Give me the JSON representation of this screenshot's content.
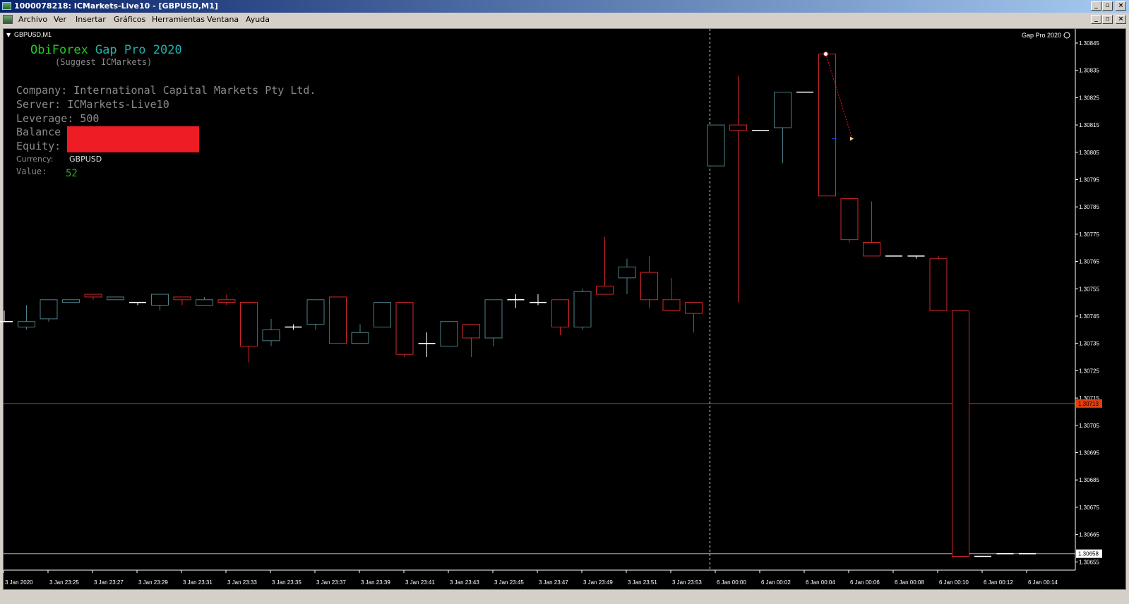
{
  "window": {
    "title": "1000078218: ICMarkets-Live10 - [GBPUSD,M1]"
  },
  "menu": [
    "Archivo",
    "Ver",
    "Insertar",
    "Gráficos",
    "Herramientas",
    "Ventana",
    "Ayuda"
  ],
  "chart": {
    "symbol_label": "GBPUSD,M1",
    "indicator_label": "Gap Pro 2020",
    "overlay": {
      "title_part1": "ObiForex",
      "title_part2": "Gap Pro 2020",
      "subtitle": "(Suggest ICMarkets)",
      "company": "Company: International Capital Markets Pty Ltd.",
      "server": "Server: ICMarkets-Live10",
      "leverage": "Leverage: 500",
      "balance_label": "Balance",
      "equity_label": "Equity:",
      "currency_label": "Currency:",
      "currency_value": "GBPUSD",
      "value_label": "Value:",
      "value_value": "52"
    },
    "price_labels": [
      "1.30845",
      "1.30835",
      "1.30825",
      "1.30815",
      "1.30805",
      "1.30795",
      "1.30785",
      "1.30775",
      "1.30765",
      "1.30755",
      "1.30745",
      "1.30735",
      "1.30725",
      "1.30715",
      "1.30705",
      "1.30695",
      "1.30685",
      "1.30675",
      "1.30665",
      "1.30655"
    ],
    "hline_red_price": 1.30713,
    "hline_red_label": "1.30713",
    "hline_gray_price": 1.30658,
    "hline_gray_label": "1.30658",
    "time_labels": [
      "3 Jan 2020",
      "3 Jan 23:25",
      "3 Jan 23:27",
      "3 Jan 23:29",
      "3 Jan 23:31",
      "3 Jan 23:33",
      "3 Jan 23:35",
      "3 Jan 23:37",
      "3 Jan 23:39",
      "3 Jan 23:41",
      "3 Jan 23:43",
      "3 Jan 23:45",
      "3 Jan 23:47",
      "3 Jan 23:49",
      "3 Jan 23:51",
      "3 Jan 23:53",
      "6 Jan 00:00",
      "6 Jan 00:02",
      "6 Jan 00:04",
      "6 Jan 00:06",
      "6 Jan 00:08",
      "6 Jan 00:10",
      "6 Jan 00:12",
      "6 Jan 00:14"
    ],
    "period_separator_after_bar": 31,
    "colors": {
      "bull": "#4d7f88",
      "bear": "#d22727",
      "doji": "#ffffff",
      "grid_red": "#c0392b",
      "balance_box": "#ee1c25",
      "title_green": "#22cc22",
      "title_teal": "#20b2aa",
      "info_gray": "#8a8a8a",
      "value_green": "#22aa22"
    },
    "candles": [
      {
        "o": 1.30743,
        "h": 1.30747,
        "l": 1.30743,
        "c": 1.30743
      },
      {
        "o": 1.30741,
        "h": 1.30749,
        "l": 1.3074,
        "c": 1.30743
      },
      {
        "o": 1.30744,
        "h": 1.30751,
        "l": 1.30743,
        "c": 1.30751
      },
      {
        "o": 1.3075,
        "h": 1.30751,
        "l": 1.3075,
        "c": 1.30751
      },
      {
        "o": 1.30753,
        "h": 1.30753,
        "l": 1.30751,
        "c": 1.30752
      },
      {
        "o": 1.30751,
        "h": 1.30752,
        "l": 1.30751,
        "c": 1.30752
      },
      {
        "o": 1.3075,
        "h": 1.3075,
        "l": 1.30749,
        "c": 1.3075
      },
      {
        "o": 1.30749,
        "h": 1.30753,
        "l": 1.30747,
        "c": 1.30753
      },
      {
        "o": 1.30752,
        "h": 1.30752,
        "l": 1.30749,
        "c": 1.30751
      },
      {
        "o": 1.30749,
        "h": 1.30752,
        "l": 1.30749,
        "c": 1.30751
      },
      {
        "o": 1.30751,
        "h": 1.30753,
        "l": 1.30749,
        "c": 1.3075
      },
      {
        "o": 1.3075,
        "h": 1.3075,
        "l": 1.30728,
        "c": 1.30734
      },
      {
        "o": 1.30736,
        "h": 1.30744,
        "l": 1.30734,
        "c": 1.3074
      },
      {
        "o": 1.30741,
        "h": 1.30742,
        "l": 1.3074,
        "c": 1.30741
      },
      {
        "o": 1.30742,
        "h": 1.30751,
        "l": 1.3074,
        "c": 1.30751
      },
      {
        "o": 1.30752,
        "h": 1.30752,
        "l": 1.30735,
        "c": 1.30735
      },
      {
        "o": 1.30735,
        "h": 1.30742,
        "l": 1.30735,
        "c": 1.30739
      },
      {
        "o": 1.30741,
        "h": 1.3075,
        "l": 1.30741,
        "c": 1.3075
      },
      {
        "o": 1.3075,
        "h": 1.3075,
        "l": 1.3073,
        "c": 1.30731
      },
      {
        "o": 1.30735,
        "h": 1.30739,
        "l": 1.3073,
        "c": 1.30735
      },
      {
        "o": 1.30734,
        "h": 1.30743,
        "l": 1.30734,
        "c": 1.30743
      },
      {
        "o": 1.30742,
        "h": 1.30742,
        "l": 1.3073,
        "c": 1.30737
      },
      {
        "o": 1.30737,
        "h": 1.30751,
        "l": 1.30734,
        "c": 1.30751
      },
      {
        "o": 1.30751,
        "h": 1.30753,
        "l": 1.30748,
        "c": 1.30751
      },
      {
        "o": 1.3075,
        "h": 1.30753,
        "l": 1.30749,
        "c": 1.3075
      },
      {
        "o": 1.30751,
        "h": 1.30751,
        "l": 1.30738,
        "c": 1.30741
      },
      {
        "o": 1.30741,
        "h": 1.30755,
        "l": 1.3074,
        "c": 1.30754
      },
      {
        "o": 1.30756,
        "h": 1.30774,
        "l": 1.30753,
        "c": 1.30753
      },
      {
        "o": 1.30759,
        "h": 1.30766,
        "l": 1.30753,
        "c": 1.30763
      },
      {
        "o": 1.30761,
        "h": 1.30767,
        "l": 1.30748,
        "c": 1.30751
      },
      {
        "o": 1.30751,
        "h": 1.30759,
        "l": 1.30747,
        "c": 1.30747
      },
      {
        "o": 1.3075,
        "h": 1.3075,
        "l": 1.30739,
        "c": 1.30746
      },
      {
        "o": 1.308,
        "h": 1.30815,
        "l": 1.308,
        "c": 1.30815
      },
      {
        "o": 1.30815,
        "h": 1.30833,
        "l": 1.3075,
        "c": 1.30813
      },
      {
        "o": 1.30813,
        "h": 1.30813,
        "l": 1.30813,
        "c": 1.30813
      },
      {
        "o": 1.30814,
        "h": 1.30827,
        "l": 1.30801,
        "c": 1.30827
      },
      {
        "o": 1.30827,
        "h": 1.30827,
        "l": 1.30827,
        "c": 1.30827
      },
      {
        "o": 1.30841,
        "h": 1.30841,
        "l": 1.30789,
        "c": 1.30789
      },
      {
        "o": 1.30788,
        "h": 1.30788,
        "l": 1.30772,
        "c": 1.30773
      },
      {
        "o": 1.30772,
        "h": 1.30787,
        "l": 1.30768,
        "c": 1.30767
      },
      {
        "o": 1.30767,
        "h": 1.30767,
        "l": 1.30767,
        "c": 1.30767
      },
      {
        "o": 1.30767,
        "h": 1.30767,
        "l": 1.30766,
        "c": 1.30767
      },
      {
        "o": 1.30766,
        "h": 1.30767,
        "l": 1.30747,
        "c": 1.30747
      },
      {
        "o": 1.30747,
        "h": 1.30747,
        "l": 1.30657,
        "c": 1.30657
      },
      {
        "o": 1.30657,
        "h": 1.30657,
        "l": 1.30657,
        "c": 1.30657
      },
      {
        "o": 1.30658,
        "h": 1.30658,
        "l": 1.30658,
        "c": 1.30658
      },
      {
        "o": 1.30658,
        "h": 1.30658,
        "l": 1.30658,
        "c": 1.30658
      }
    ]
  }
}
